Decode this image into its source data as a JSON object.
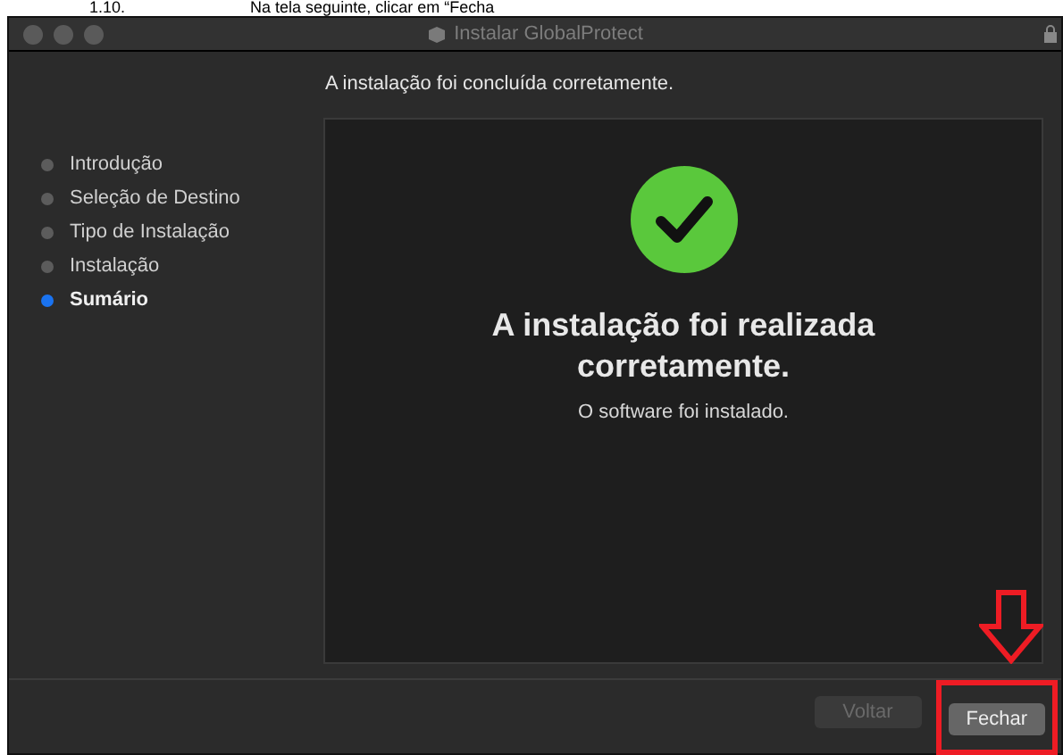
{
  "document_heading": {
    "number": "1.10.",
    "text": "Na tela seguinte, clicar em “Fecha"
  },
  "window": {
    "title": "Instalar GlobalProtect"
  },
  "subtitle": "A instalação foi concluída corretamente.",
  "sidebar": {
    "items": [
      {
        "label": "Introdução",
        "selected": false
      },
      {
        "label": "Seleção de Destino",
        "selected": false
      },
      {
        "label": "Tipo de Instalação",
        "selected": false
      },
      {
        "label": "Instalação",
        "selected": false
      },
      {
        "label": "Sumário",
        "selected": true
      }
    ]
  },
  "content": {
    "heading": "A instalação foi realizada corretamente.",
    "message": "O software foi instalado."
  },
  "buttons": [
    {
      "label": "Voltar",
      "disabled": true,
      "highlighted": false
    },
    {
      "label": "Fechar",
      "disabled": false,
      "highlighted": true
    }
  ]
}
